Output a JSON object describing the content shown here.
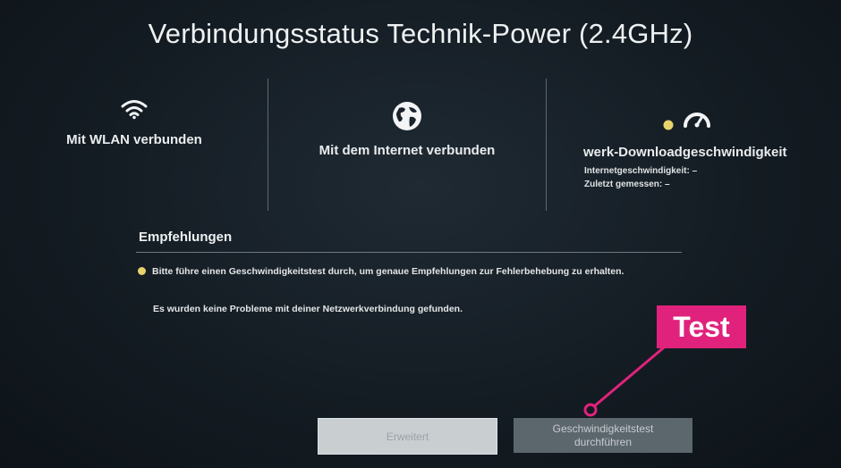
{
  "title": "Verbindungsstatus Technik-Power (2.4GHz)",
  "status": {
    "wlan": {
      "label": "Mit WLAN verbunden",
      "icon": "wifi-icon"
    },
    "internet": {
      "label": "Mit dem Internet verbunden",
      "icon": "globe-icon"
    },
    "speed": {
      "icon": "speedometer-icon",
      "heading": "werk-Downloadgeschwindigkeit",
      "internet_speed": "Internetgeschwindigkeit: –",
      "last_measured": "Zuletzt gemessen: –"
    }
  },
  "recommendations": {
    "title": "Empfehlungen",
    "items": [
      "Bitte führe einen Geschwindigkeitstest durch, um genaue Empfehlungen zur Fehlerbehebung zu erhalten.",
      "Es wurden keine Probleme mit deiner Netzwerkverbindung gefunden."
    ]
  },
  "buttons": {
    "advanced": "Erweitert",
    "speedtest": "Geschwindigkeitstest durchführen"
  },
  "annotation": {
    "label": "Test",
    "color": "#e0227d"
  },
  "colors": {
    "warning": "#e7d36b",
    "background": "#141c23"
  }
}
